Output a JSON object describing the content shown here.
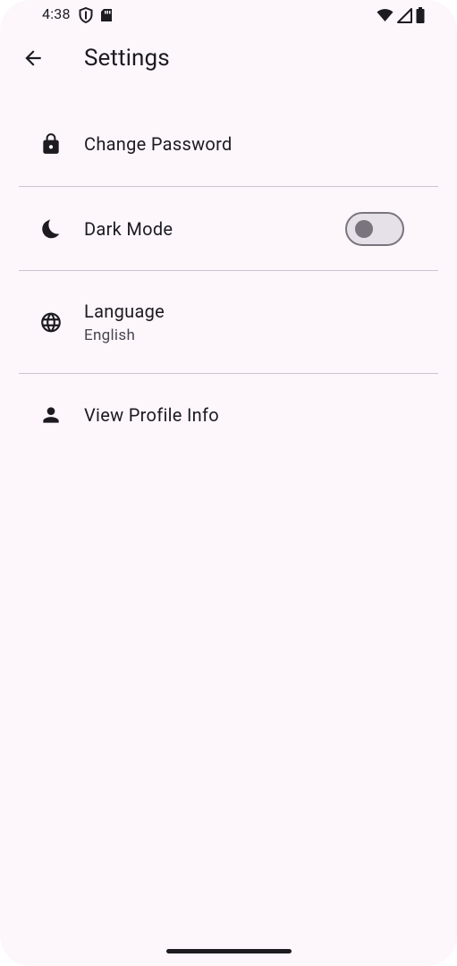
{
  "status_bar": {
    "time": "4:38",
    "icons": [
      "shield-icon",
      "sd-card-icon",
      "wifi-icon",
      "signal-icon",
      "battery-icon"
    ]
  },
  "app_bar": {
    "back_icon": "arrow-back-icon",
    "title": "Settings"
  },
  "settings": {
    "items": [
      {
        "icon": "lock-icon",
        "label": "Change Password"
      },
      {
        "icon": "moon-icon",
        "label": "Dark Mode",
        "toggle_on": false
      },
      {
        "icon": "globe-icon",
        "label": "Language",
        "sublabel": "English"
      },
      {
        "icon": "person-icon",
        "label": "View Profile Info"
      }
    ]
  },
  "colors": {
    "background": "#fdf7fc",
    "text": "#1d1b20",
    "subtext": "#49454f",
    "divider": "#cac4d0",
    "toggle_outline": "#79747e",
    "toggle_track": "#e6e0e9"
  }
}
